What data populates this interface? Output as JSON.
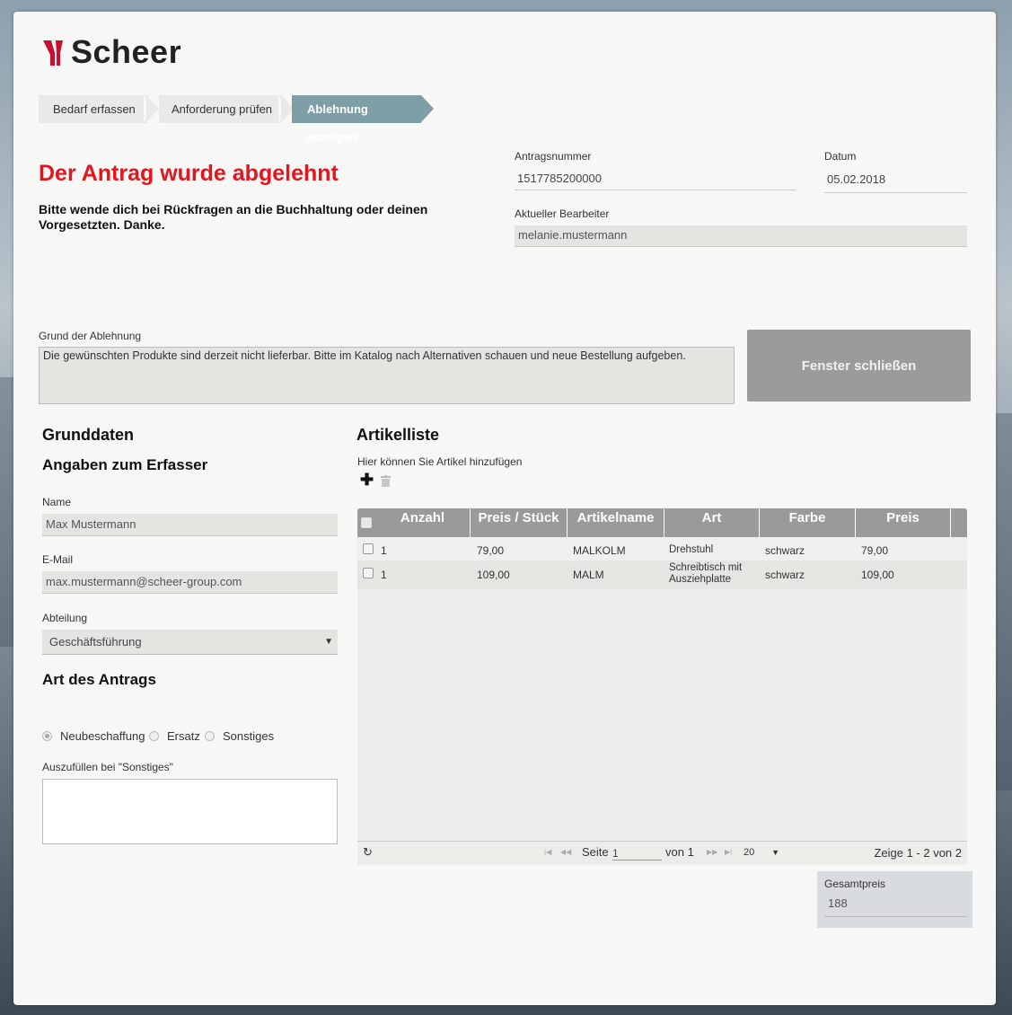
{
  "brand": {
    "name": "Scheer"
  },
  "steps": [
    {
      "label": "Bedarf erfassen",
      "active": false
    },
    {
      "label": "Anforderung prüfen",
      "active": false
    },
    {
      "label": "Ablehnung anzeigen",
      "active": true
    }
  ],
  "header": {
    "title": "Der Antrag wurde abgelehnt",
    "message": "Bitte wende dich bei Rückfragen an die Buchhaltung oder deinen Vorgesetzten. Danke."
  },
  "request": {
    "number_label": "Antragsnummer",
    "number_value": "1517785200000",
    "date_label": "Datum",
    "date_value": "05.02.2018",
    "editor_label": "Aktueller Bearbeiter",
    "editor_value": "melanie.mustermann"
  },
  "rejection": {
    "label": "Grund der Ablehnung",
    "text": "Die gewünschten Produkte sind derzeit nicht lieferbar. Bitte im Katalog nach Alternativen schauen und neue Bestellung aufgeben."
  },
  "close_button": "Fenster schließen",
  "basics": {
    "title": "Grunddaten",
    "subtitle": "Angaben zum Erfasser",
    "name_label": "Name",
    "name_value": "Max Mustermann",
    "email_label": "E-Mail",
    "email_value": "max.mustermann@scheer-group.com",
    "dept_label": "Abteilung",
    "dept_value": "Geschäftsführung",
    "type_title": "Art des Antrags",
    "type_options": [
      "Neubeschaffung",
      "Ersatz",
      "Sonstiges"
    ],
    "type_selected": "Neubeschaffung",
    "other_label": "Auszufüllen bei \"Sonstiges\""
  },
  "articles": {
    "title": "Artikelliste",
    "hint": "Hier können Sie Artikel hinzufügen",
    "add_icon": "plus-icon",
    "delete_icon": "trash-icon",
    "columns": [
      "Anzahl",
      "Preis / Stück",
      "Artikelname",
      "Art",
      "Farbe",
      "Preis"
    ],
    "rows": [
      [
        "1",
        "79,00",
        "MALKOLM",
        "Drehstuhl",
        "schwarz",
        "79,00"
      ],
      [
        "1",
        "109,00",
        "MALM",
        "Schreibtisch mit Ausziehplatte",
        "schwarz",
        "109,00"
      ]
    ],
    "pager": {
      "page_label": "Seite",
      "page_value": "1",
      "of_label": "von 1",
      "page_size": "20",
      "summary": "Zeige 1 - 2 von 2"
    }
  },
  "total": {
    "label": "Gesamtpreis",
    "value": "188"
  }
}
